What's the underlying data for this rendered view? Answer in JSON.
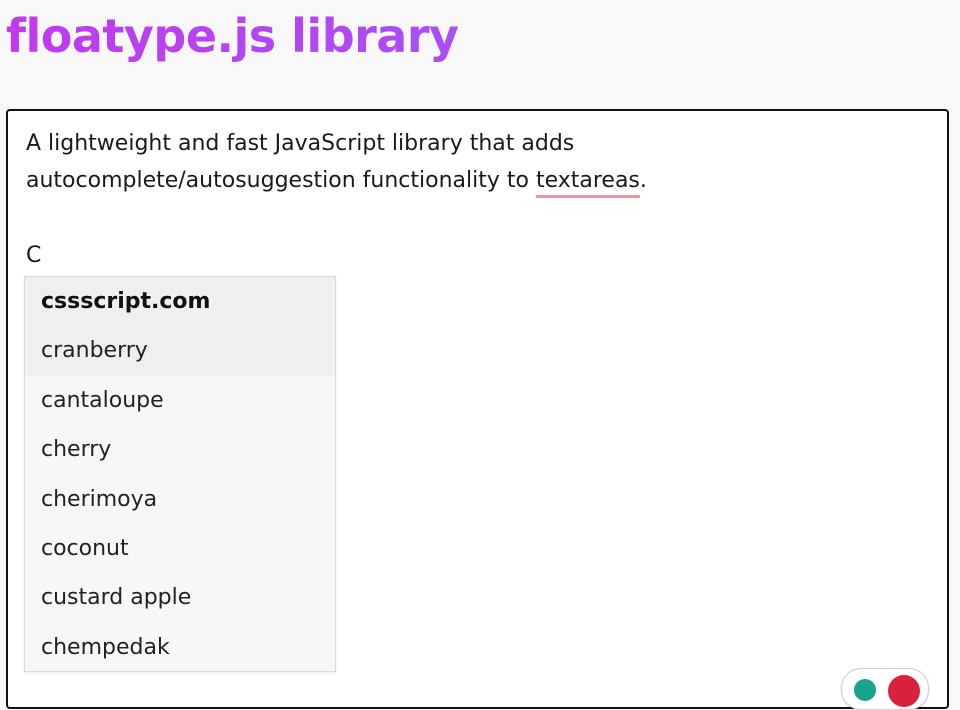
{
  "header": {
    "title": "floatype.js library"
  },
  "editor": {
    "text_before": "A lightweight and fast JavaScript library that adds\nautocomplete/autosuggestion functionality to ",
    "misspelled_word": "textareas",
    "text_after": ".",
    "typed_text": "C"
  },
  "suggestions": {
    "items": [
      {
        "label": "cssscript.com",
        "bold": true,
        "active": true
      },
      {
        "label": "cranberry",
        "bold": false,
        "active": true
      },
      {
        "label": "cantaloupe",
        "bold": false,
        "active": false
      },
      {
        "label": "cherry",
        "bold": false,
        "active": false
      },
      {
        "label": "cherimoya",
        "bold": false,
        "active": false
      },
      {
        "label": "coconut",
        "bold": false,
        "active": false
      },
      {
        "label": "custard apple",
        "bold": false,
        "active": false
      },
      {
        "label": "chempedak",
        "bold": false,
        "active": false
      }
    ]
  },
  "extension_widget": {
    "left_icon": "grammarly-icon",
    "right_icon": "language-tool-icon",
    "colors": {
      "left": "#16a58b",
      "right": "#d9213b"
    }
  },
  "colors": {
    "title": "#b03cf0",
    "misspell_underline": "#f090a0",
    "border": "#111111"
  }
}
